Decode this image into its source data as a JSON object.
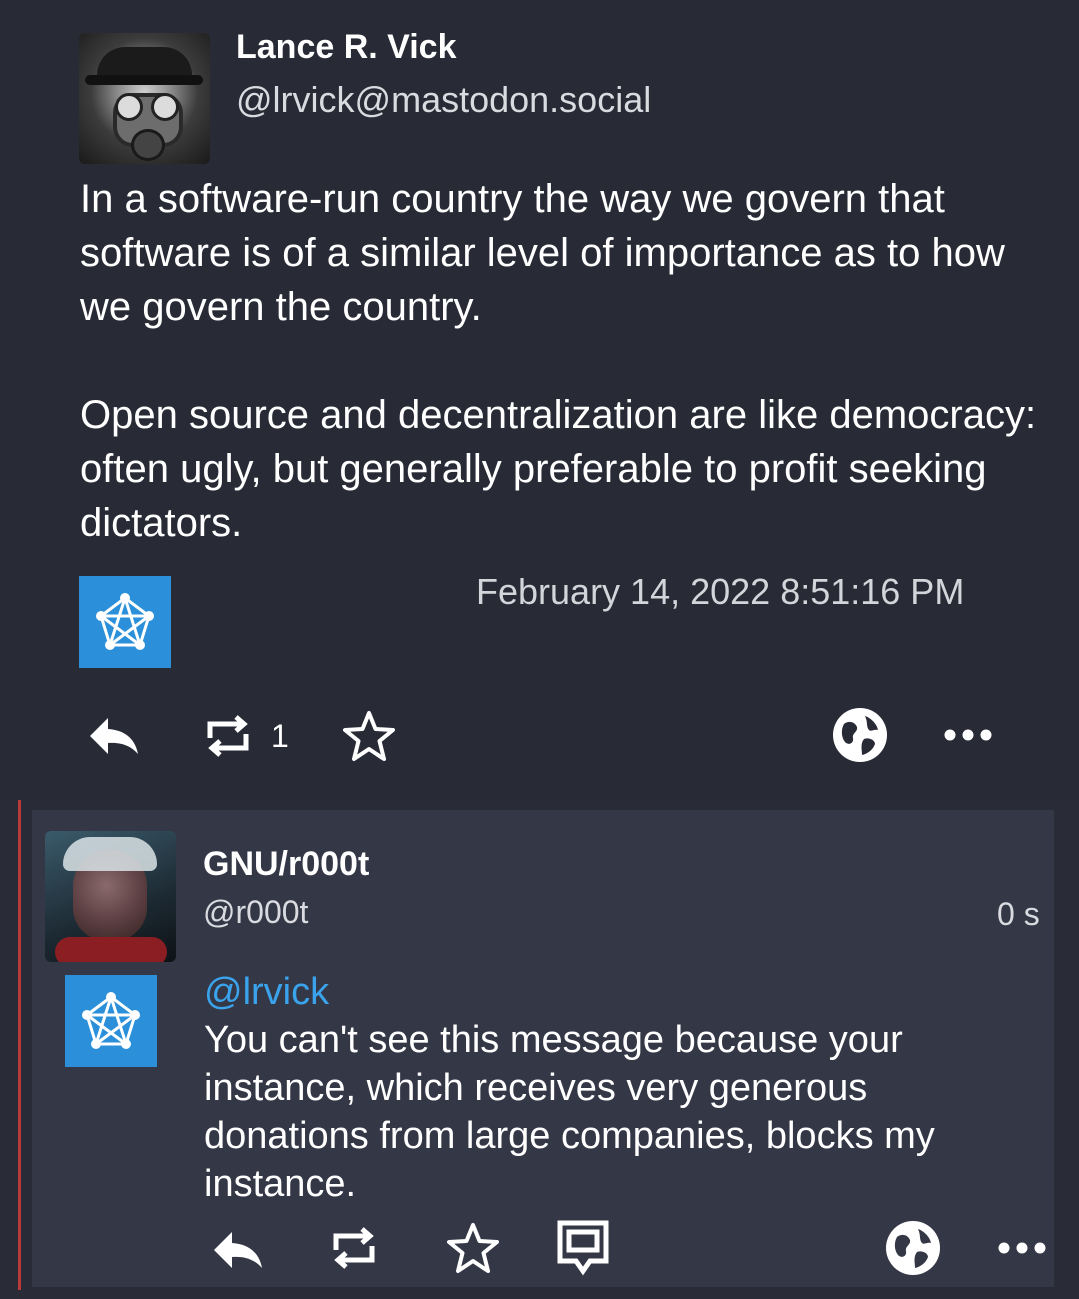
{
  "original": {
    "author_name": "Lance R. Vick",
    "author_handle": "@lrvick@mastodon.social",
    "paragraphs": [
      "In a software-run country the way we govern that software is of a similar level of importance as to how we govern the country.",
      "Open source and decentralization are like democracy: often ugly, but generally preferable to profit seeking dictators."
    ],
    "timestamp": "February 14, 2022 8:51:16 PM",
    "boost_count": "1"
  },
  "reply": {
    "author_name": "GNU/r000t",
    "author_handle": "@r000t",
    "relative_time": "0 s",
    "mention": "@lrvick",
    "text": "You can't see this message because your instance, which receives very generous donations from large companies, blocks my instance."
  },
  "icons": {
    "reply": "reply-icon",
    "boost": "boost-icon",
    "favourite": "star-icon",
    "visibility": "globe-icon",
    "more": "more-icon",
    "quote": "quote-icon",
    "app": "fediverse-icon"
  },
  "colors": {
    "background": "#282b35",
    "reply_background": "#343846",
    "accent": "#2b90d9",
    "mention": "#3aa3ec",
    "thread_line": "#b83a3a"
  }
}
